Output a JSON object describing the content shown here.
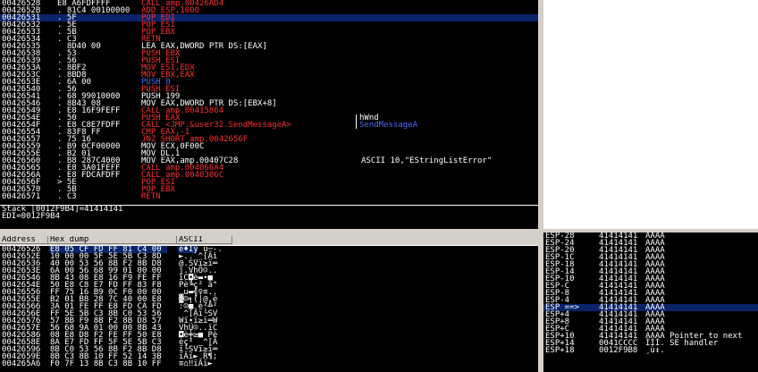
{
  "disasm": [
    {
      "addr": "00426528",
      "hex": "E8 A6FDFFFF",
      "ins": "CALL amp.00426AD4",
      "ins_color": "#ff3030",
      "cmt": ""
    },
    {
      "addr": "0042652B",
      "hex": ". 81C4 00100000",
      "ins": "ADD ESP,1000",
      "ins_color": "#ff3030",
      "cmt": ""
    },
    {
      "addr": "00426531",
      "hex": ". 5F",
      "ins": "POP EDI",
      "ins_color": "#ff3030",
      "cmt": "",
      "selected": true
    },
    {
      "addr": "00426532",
      "hex": ". 5E",
      "ins": "POP ESI",
      "ins_color": "#ff3030",
      "cmt": ""
    },
    {
      "addr": "00426533",
      "hex": ". 5B",
      "ins": "POP EBX",
      "ins_color": "#ff3030",
      "cmt": ""
    },
    {
      "addr": "00426534",
      "hex": ". C3",
      "ins": "RETN",
      "ins_color": "#ff3030",
      "cmt": ""
    },
    {
      "addr": "00426535",
      "hex": "  8D40 00",
      "ins": "LEA EAX,DWORD PTR DS:[EAX]",
      "ins_color": "#ffffff",
      "cmt": ""
    },
    {
      "addr": "00426538",
      "hex": ". 53",
      "ins": "PUSH EBX",
      "ins_color": "#ff3030",
      "cmt": ""
    },
    {
      "addr": "00426539",
      "hex": ". 56",
      "ins": "PUSH ESI",
      "ins_color": "#ff3030",
      "cmt": ""
    },
    {
      "addr": "0042653A",
      "hex": ". 8BF2",
      "ins": "MOV ESI,EDX",
      "ins_color": "#ff3030",
      "cmt": ""
    },
    {
      "addr": "0042653C",
      "hex": ". 8BD8",
      "ins": "MOV EBX,EAX",
      "ins_color": "#ff3030",
      "cmt": ""
    },
    {
      "addr": "0042653E",
      "hex": ". 6A 00",
      "ins": "PUSH 0",
      "ins_color": "#4a6cff",
      "cmt": ""
    },
    {
      "addr": "00426540",
      "hex": ". 56",
      "ins": "PUSH ESI",
      "ins_color": "#ff3030",
      "cmt": ""
    },
    {
      "addr": "00426541",
      "hex": ". 68 99010000",
      "ins": "PUSH 199",
      "ins_color": "#ffffff",
      "cmt": ""
    },
    {
      "addr": "00426546",
      "hex": ". 8B43 08",
      "ins": "MOV EAX,DWORD PTR DS:[EBX+8]",
      "ins_color": "#ffffff",
      "cmt": ""
    },
    {
      "addr": "00426549",
      "hex": ". E8 16F9FEFF",
      "ins": "CALL amp.00415864",
      "ins_color": "#ff3030",
      "cmt": ""
    },
    {
      "addr": "0042654E",
      "hex": ". 50",
      "ins": "PUSH EAX",
      "ins_color": "#ff3030",
      "cmt": "hWnd"
    },
    {
      "addr": "0042654F",
      "hex": ". E8 C8E7FDFF",
      "ins": "CALL <JMP.&user32.SendMessageA>",
      "ins_color": "#ff3030",
      "cmt": "SendMessageA"
    },
    {
      "addr": "00426554",
      "hex": ". 83F8 FF",
      "ins": "CMP EAX,-1",
      "ins_color": "#ff3030",
      "cmt": ""
    },
    {
      "addr": "00426557",
      "hex": ". 75 16",
      "ins": "JNZ SHORT amp.0042656F",
      "ins_color": "#ff3030",
      "cmt": ""
    },
    {
      "addr": "00426559",
      "hex": ". B9 0CF00000",
      "ins": "MOV ECX,0F00C",
      "ins_color": "#ffffff",
      "cmt": ""
    },
    {
      "addr": "0042655E",
      "hex": ". B2 01",
      "ins": "MOV DL,1",
      "ins_color": "#ffffff",
      "cmt": ""
    },
    {
      "addr": "00426560",
      "hex": ". B8 287C4000",
      "ins": "MOV EAX,amp.00407C28",
      "ins_color": "#ffffff",
      "cmt": "ASCII 10,\"EStringListError\""
    },
    {
      "addr": "00426565",
      "hex": ". E8 3A01FEFF",
      "ins": "CALL amp.004066A4",
      "ins_color": "#ff3030",
      "cmt": ""
    },
    {
      "addr": "0042656A",
      "hex": ". E8 FDCAFDFF",
      "ins": "CALL amp.0040306C",
      "ins_color": "#ff3030",
      "cmt": ""
    },
    {
      "addr": "0042656F",
      "hex": "> 5E",
      "ins": "POP ESI",
      "ins_color": "#ff3030",
      "cmt": ""
    },
    {
      "addr": "00426570",
      "hex": ". 5B",
      "ins": "POP EBX",
      "ins_color": "#ff3030",
      "cmt": ""
    },
    {
      "addr": "00426571",
      "hex": ". C3",
      "ins": "RETN",
      "ins_color": "#ff3030",
      "cmt": ""
    }
  ],
  "info": {
    "line1": "Stack [0012F9B4]=41414141",
    "line2": "EDI=0012F9B4"
  },
  "dump_header": {
    "address": "Address",
    "hex": "Hex dump",
    "ascii": "ASCII"
  },
  "dump": [
    {
      "addr": "00426526",
      "hex": "E8 05 CF FD FF 81 C4 00",
      "asc": "è♦Ïý ü─-."
    },
    {
      "addr": "0042652E",
      "hex": "10 00 00 5F 5E 5B C3 8D",
      "asc": "►.._^[Ãì"
    },
    {
      "addr": "00426536",
      "hex": "40 00 53 56 8B F2 8B D8",
      "asc": "@.SVï≥ï═"
    },
    {
      "addr": "0042653E",
      "hex": "6A 00 56 68 99 01 00 00",
      "asc": "j.VhÖ☺.."
    },
    {
      "addr": "00426546",
      "hex": "8B 43 08 E8 16 F9 FE FF",
      "asc": "ïC◘è▬∙■ "
    },
    {
      "addr": "0042654E",
      "hex": "50 E8 C8 E7 FD FF 83 F8",
      "asc": "Pè╚ç² â°"
    },
    {
      "addr": "00426556",
      "hex": "FF 75 16 B9 0C F0 00 00",
      "asc": " u▬╣♀≡.."
    },
    {
      "addr": "0042655E",
      "hex": "B2 01 B8 28 7C 40 00 E8",
      "asc": "▓☺╕(|@.è"
    },
    {
      "addr": "00426566",
      "hex": "3A 01 FE FF E8 FD CA FD",
      "asc": ":☺■ è²╩²"
    },
    {
      "addr": "0042656E",
      "hex": "FF 5E 5B C3 8B C0 53 56",
      "asc": " ^[Ãï└SV"
    },
    {
      "addr": "00426576",
      "hex": "57 8B F9 8B F2 8B D8 57",
      "asc": "Wï∙ï≥ï═W"
    },
    {
      "addr": "0042657E",
      "hex": "56 68 9A 01 00 00 8B 43",
      "asc": "VhÜ☺..ïC"
    },
    {
      "addr": "00426586",
      "hex": "08 E8 D8 F2 FE FF 50 E8",
      "asc": "◘è╪≥■ Pè"
    },
    {
      "addr": "0042658E",
      "hex": "8A E7 FD FF 5F 5E 5B C3",
      "asc": "èç² _^[Ã"
    },
    {
      "addr": "00426596",
      "hex": "8B C0 53 56 8B F2 8B D8",
      "asc": "ï└SVï≥ï═"
    },
    {
      "addr": "0042659E",
      "hex": "8B C3 8B 10 FF 52 14 3B",
      "asc": "ïÃï► R¶;"
    },
    {
      "addr": "004265A6",
      "hex": "F0 7F 13 8B C3 8B 10 FF",
      "asc": "≡⌂‼ïÃï► "
    }
  ],
  "stack": [
    {
      "lbl": "ESP-28",
      "val": "41414141",
      "cm": "AAAA"
    },
    {
      "lbl": "ESP-24",
      "val": "41414141",
      "cm": "AAAA"
    },
    {
      "lbl": "ESP-20",
      "val": "41414141",
      "cm": "AAAA"
    },
    {
      "lbl": "ESP-1C",
      "val": "41414141",
      "cm": "AAAA"
    },
    {
      "lbl": "ESP-18",
      "val": "41414141",
      "cm": "AAAA"
    },
    {
      "lbl": "ESP-14",
      "val": "41414141",
      "cm": "AAAA"
    },
    {
      "lbl": "ESP-10",
      "val": "41414141",
      "cm": "AAAA"
    },
    {
      "lbl": "ESP-C",
      "val": "41414141",
      "cm": "AAAA"
    },
    {
      "lbl": "ESP-8",
      "val": "41414141",
      "cm": "AAAA"
    },
    {
      "lbl": "ESP-4",
      "val": "41414141",
      "cm": "AAAA"
    },
    {
      "lbl": "ESP ==>",
      "val": "41414141",
      "cm": "AAAA",
      "selected": true
    },
    {
      "lbl": "ESP+4",
      "val": "41414141",
      "cm": "AAAA"
    },
    {
      "lbl": "ESP+8",
      "val": "41414141",
      "cm": "AAAA"
    },
    {
      "lbl": "ESP+C",
      "val": "41414141",
      "cm": "AAAA"
    },
    {
      "lbl": "ESP+10",
      "val": "41414141",
      "cm": "AAAA Pointer to next"
    },
    {
      "lbl": "ESP+14",
      "val": "0041CCCC",
      "cm": "ÌÌÌ. SE handler"
    },
    {
      "lbl": "ESP+18",
      "val": "0012F9B8",
      "cm": "¸ù↕."
    }
  ]
}
